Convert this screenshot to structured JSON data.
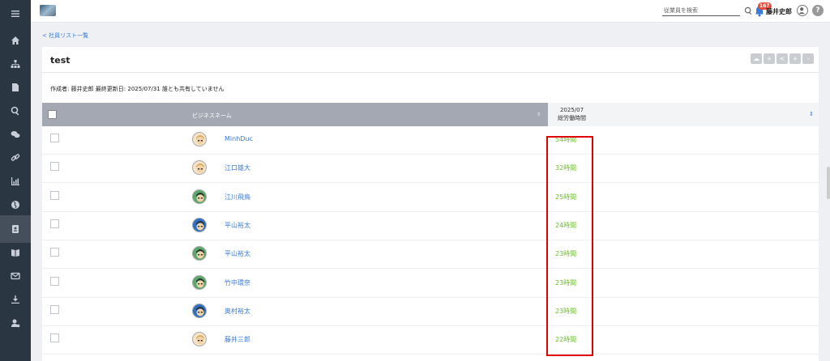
{
  "header": {
    "search_placeholder": "従業員を検索",
    "notification_count": "167",
    "user_name": "藤井史郎",
    "help_label": "?"
  },
  "sidebar": {
    "items": [
      {
        "icon": "menu-icon"
      },
      {
        "icon": "home-icon"
      },
      {
        "icon": "org-chart-icon"
      },
      {
        "icon": "document-icon"
      },
      {
        "icon": "search-icon"
      },
      {
        "icon": "chat-icon"
      },
      {
        "icon": "link-icon"
      },
      {
        "icon": "chart-icon"
      },
      {
        "icon": "globe-icon"
      },
      {
        "icon": "profile-card-icon",
        "active": true
      },
      {
        "icon": "book-icon"
      },
      {
        "icon": "mail-icon"
      },
      {
        "icon": "download-icon"
      },
      {
        "icon": "user-settings-icon"
      }
    ]
  },
  "breadcrumb": "< 社員リスト一覧",
  "card": {
    "title": "test",
    "meta": "作成者: 藤井史郎  最終更新日: 2025/07/31  誰とも共有していません",
    "tools": [
      "☁",
      "+",
      "<",
      "+",
      "-"
    ]
  },
  "table": {
    "name_header": "ビジネスネーム",
    "sort_icon": "⇕",
    "col_month": "2025/07",
    "col_label": "総労働時間",
    "sort2_icon": "⇕",
    "rows": [
      {
        "name": "MinhDuc",
        "hours": "54時間",
        "avatar": "beige"
      },
      {
        "name": "江口雄大",
        "hours": "32時間",
        "avatar": "beige"
      },
      {
        "name": "江川飛鳥",
        "hours": "25時間",
        "avatar": "green"
      },
      {
        "name": "平山裕太",
        "hours": "24時間",
        "avatar": "blue"
      },
      {
        "name": "平山裕太",
        "hours": "23時間",
        "avatar": "green"
      },
      {
        "name": "竹中環奈",
        "hours": "23時間",
        "avatar": "green"
      },
      {
        "name": "奥村裕太",
        "hours": "23時間",
        "avatar": "blue"
      },
      {
        "name": "藤井三郎",
        "hours": "22時間",
        "avatar": "beige"
      }
    ]
  },
  "colors": {
    "sidebar": "#2b3643",
    "link": "#3a7bd5",
    "hours": "#6cbf2c",
    "highlight": "#e00000"
  }
}
